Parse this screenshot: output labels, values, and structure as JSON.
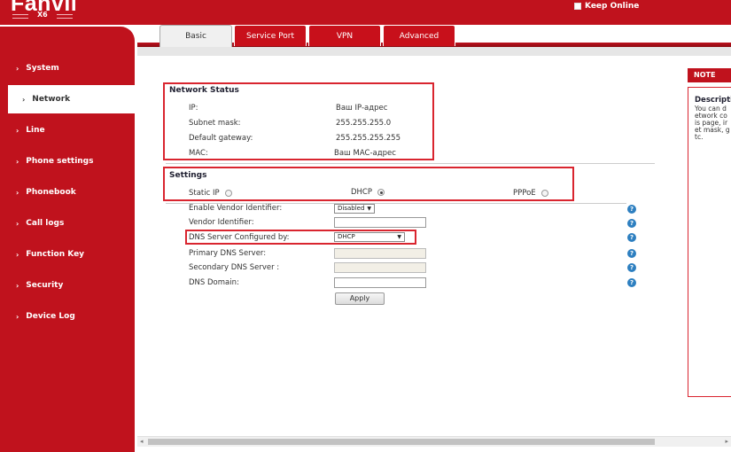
{
  "header": {
    "brand": "Fanvil",
    "model": "X6",
    "keep_online": "Keep Online"
  },
  "tabs": [
    {
      "label": "Basic",
      "active": true
    },
    {
      "label": "Service Port",
      "active": false
    },
    {
      "label": "VPN",
      "active": false
    },
    {
      "label": "Advanced",
      "active": false
    }
  ],
  "sidebar": {
    "items": [
      {
        "label": "System",
        "active": false
      },
      {
        "label": "Network",
        "active": true
      },
      {
        "label": "Line",
        "active": false
      },
      {
        "label": "Phone settings",
        "active": false
      },
      {
        "label": "Phonebook",
        "active": false
      },
      {
        "label": "Call logs",
        "active": false
      },
      {
        "label": "Function Key",
        "active": false
      },
      {
        "label": "Security",
        "active": false
      },
      {
        "label": "Device Log",
        "active": false
      }
    ]
  },
  "network_status": {
    "title": "Network Status",
    "rows": [
      {
        "label": "IP:",
        "value": "Ваш IP-адрес"
      },
      {
        "label": "Subnet mask:",
        "value": "255.255.255.0"
      },
      {
        "label": "Default gateway:",
        "value": "255.255.255.255"
      },
      {
        "label": "MAC:",
        "value": "Ваш MAC-адрес"
      }
    ]
  },
  "settings": {
    "title": "Settings",
    "modes": [
      {
        "label": "Static IP",
        "checked": false
      },
      {
        "label": "DHCP",
        "checked": true
      },
      {
        "label": "PPPoE",
        "checked": false
      }
    ],
    "enable_vendor_identifier": {
      "label": "Enable Vendor Identifier:",
      "value": "Disabled"
    },
    "vendor_identifier": {
      "label": "Vendor Identifier:",
      "value": ""
    },
    "dns_configured_by": {
      "label": "DNS Server Configured by:",
      "value": "DHCP"
    },
    "primary_dns": {
      "label": "Primary DNS Server:",
      "value": ""
    },
    "secondary_dns": {
      "label": "Secondary DNS Server :",
      "value": ""
    },
    "dns_domain": {
      "label": "DNS Domain:",
      "value": ""
    },
    "apply": "Apply",
    "help_glyph": "?"
  },
  "note": {
    "header": "NOTE",
    "title": "Descripti",
    "lines": [
      "You can d",
      "etwork co",
      "is page, ir",
      "et mask, g",
      "tc."
    ]
  },
  "scrollbar": {
    "left_arrow": "◂",
    "right_arrow": "▸"
  },
  "colors": {
    "brand_red": "#c0121d",
    "highlight_red": "#d9252f",
    "help_blue": "#2d7fc0"
  }
}
